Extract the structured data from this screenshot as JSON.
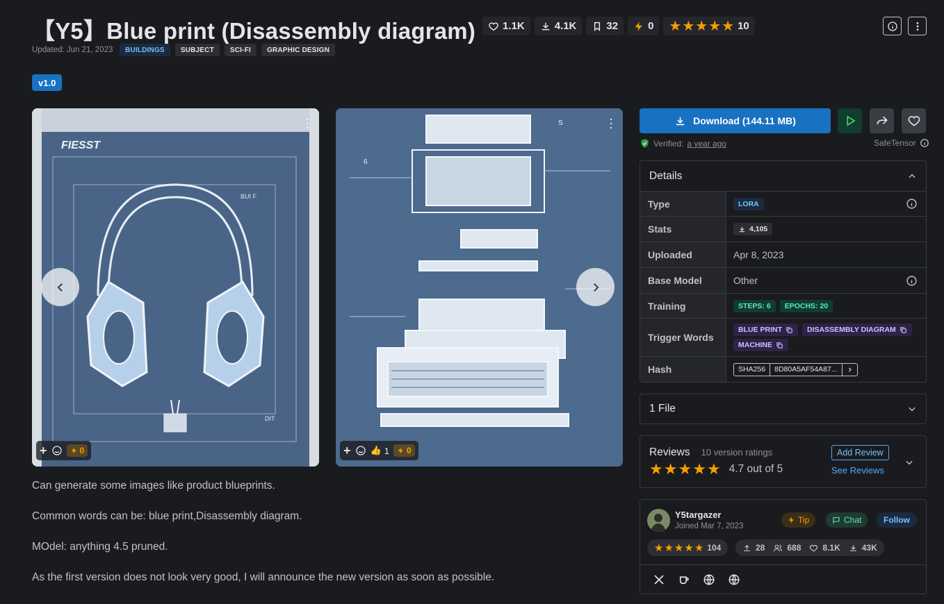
{
  "header": {
    "title": "【Y5】Blue print (Disassembly diagram)",
    "likes": "1.1K",
    "downloads": "4.1K",
    "bookmarks": "32",
    "buzz": "0",
    "rating_count": "10",
    "updated": "Updated: Jun 21, 2023",
    "tags": [
      "BUILDINGS",
      "SUBJECT",
      "SCI-FI",
      "GRAPHIC DESIGN"
    ],
    "version": "v1.0"
  },
  "gallery": {
    "card1": {
      "art_text": [
        "FIESST",
        "BUI F",
        "DIT"
      ],
      "buzz": "0"
    },
    "card2": {
      "art_text": [
        "S",
        "6"
      ],
      "likes": "1",
      "buzz": "0"
    }
  },
  "description": [
    "Can generate some images like product blueprints.",
    "Common words can be: blue print,Disassembly diagram.",
    "MOdel: anything 4.5 pruned.",
    "As the first version does not look very good, I will announce the new version as soon as possible."
  ],
  "download": {
    "label": "Download (144.11 MB)",
    "verified_label": "Verified:",
    "verified_time": "a year ago",
    "safetensor": "SafeTensor"
  },
  "details": {
    "title": "Details",
    "type_label": "Type",
    "type_value": "LORA",
    "stats_label": "Stats",
    "stats_value": "4,105",
    "uploaded_label": "Uploaded",
    "uploaded_value": "Apr 8, 2023",
    "base_label": "Base Model",
    "base_value": "Other",
    "training_label": "Training",
    "steps": "STEPS: 6",
    "epochs": "EPOCHS: 20",
    "trigger_label": "Trigger Words",
    "triggers": [
      "BLUE PRINT",
      "DISASSEMBLY DIAGRAM",
      "MACHINE"
    ],
    "hash_label": "Hash",
    "hash_algo": "SHA256",
    "hash_value": "8D80A5AF54A87..."
  },
  "files": {
    "label": "1 File"
  },
  "reviews": {
    "title": "Reviews",
    "count": "10 version ratings",
    "score": "4.7 out of 5",
    "add": "Add Review",
    "see": "See Reviews",
    "rating_value": 4.7
  },
  "creator": {
    "name": "Y5targazer",
    "joined": "Joined Mar 7, 2023",
    "tip": "Tip",
    "chat": "Chat",
    "follow": "Follow",
    "rating_count": "104",
    "uploads": "28",
    "followers": "688",
    "likes": "8.1K",
    "downloads": "43K"
  },
  "colors": {
    "accent": "#1971c2",
    "star": "#f59f00",
    "bg": "#1a1b1e"
  }
}
